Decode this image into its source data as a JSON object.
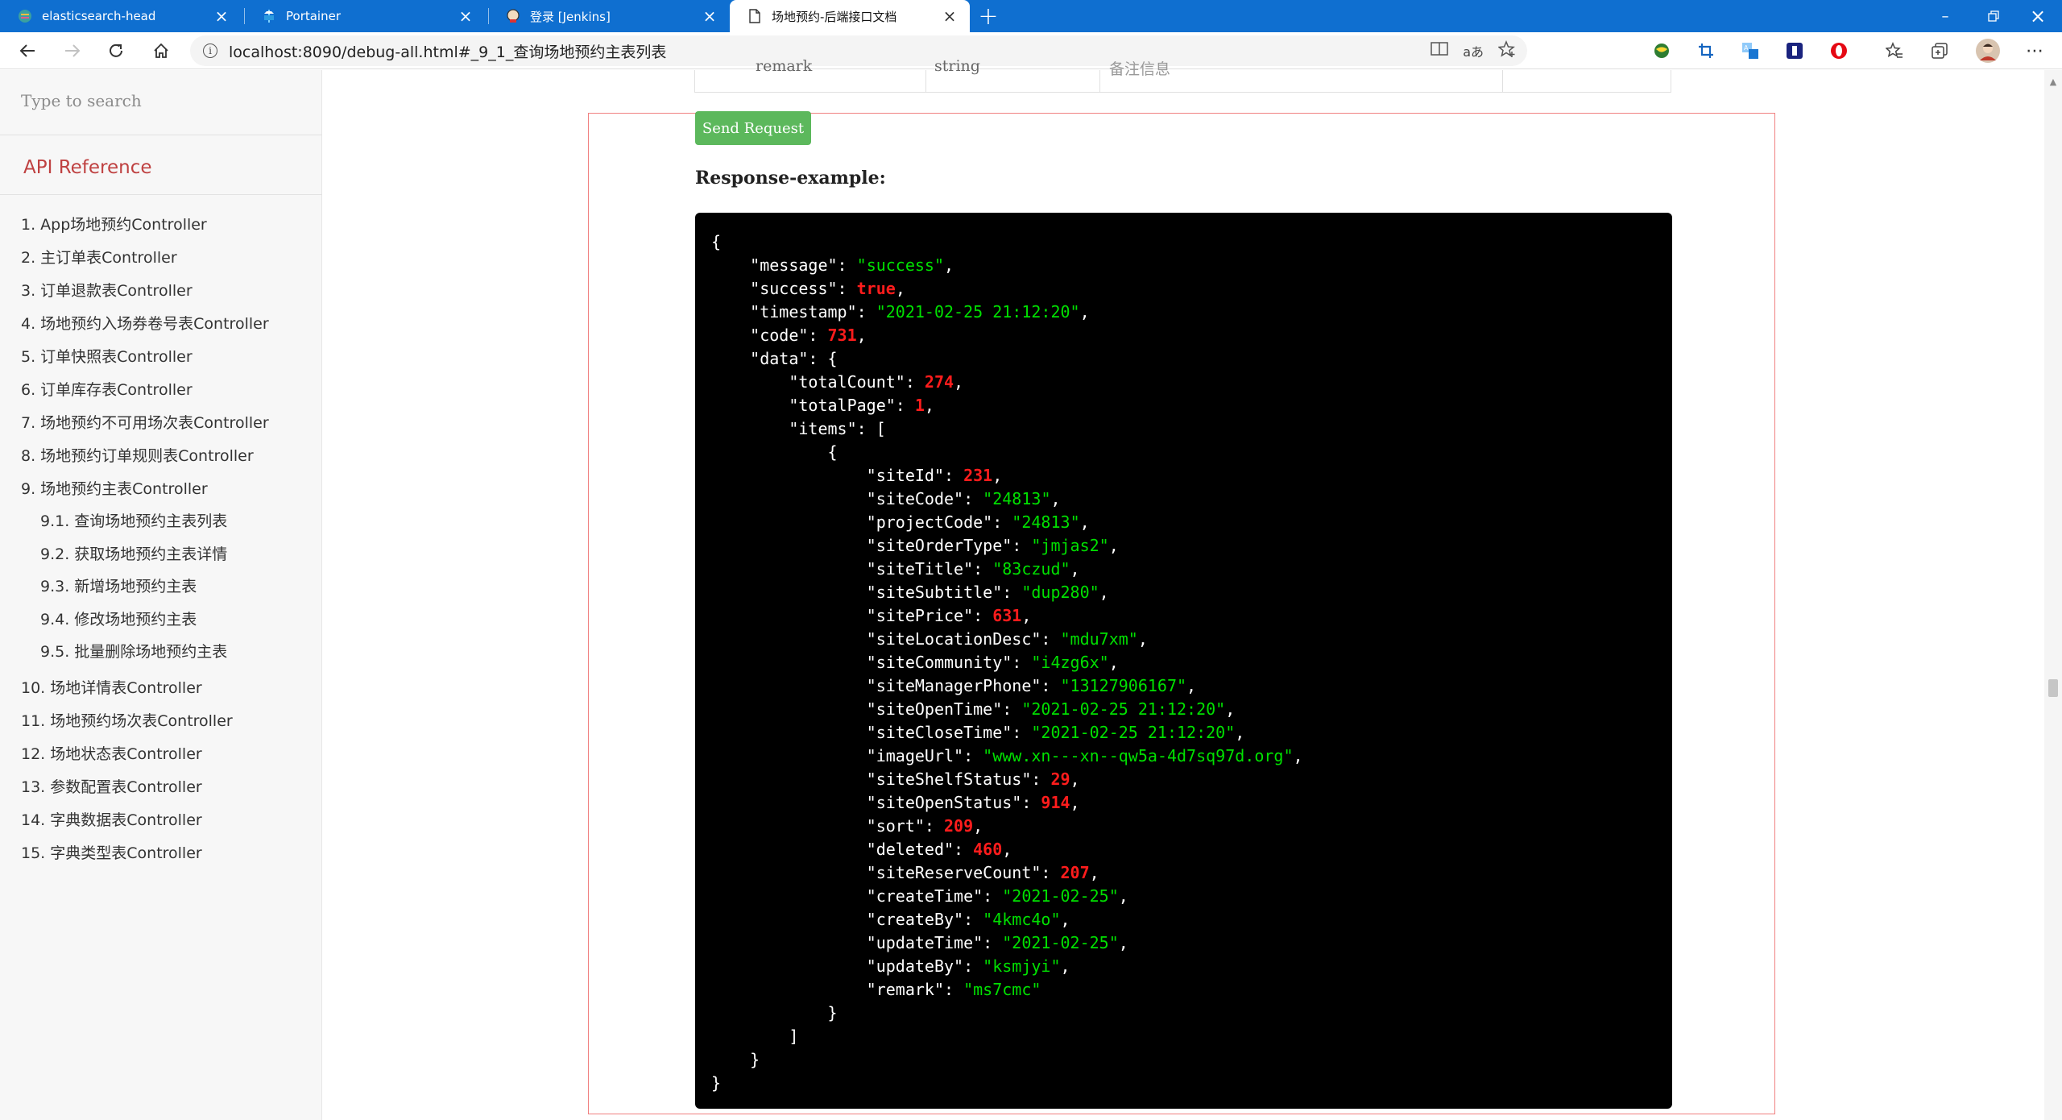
{
  "browser": {
    "tabs": [
      {
        "title": "elasticsearch-head",
        "icon": "elasticsearch-icon",
        "active": false
      },
      {
        "title": "Portainer",
        "icon": "portainer-icon",
        "active": false
      },
      {
        "title": "登录 [Jenkins]",
        "icon": "jenkins-icon",
        "active": false
      },
      {
        "title": "场地预约-后端接口文档",
        "icon": "document-icon",
        "active": true
      }
    ],
    "url": "localhost:8090/debug-all.html#_9_1_查询场地预约主表列表"
  },
  "sidebar": {
    "search_placeholder": "Type to search",
    "section_title": "API Reference",
    "items": [
      {
        "label": "1. App场地预约Controller",
        "level": 1
      },
      {
        "label": "2. 主订单表Controller",
        "level": 1
      },
      {
        "label": "3. 订单退款表Controller",
        "level": 1
      },
      {
        "label": "4. 场地预约入场券卷号表Controller",
        "level": 1
      },
      {
        "label": "5. 订单快照表Controller",
        "level": 1
      },
      {
        "label": "6. 订单库存表Controller",
        "level": 1
      },
      {
        "label": "7. 场地预约不可用场次表Controller",
        "level": 1
      },
      {
        "label": "8. 场地预约订单规则表Controller",
        "level": 1
      },
      {
        "label": "9. 场地预约主表Controller",
        "level": 1
      },
      {
        "label": "9.1. 查询场地预约主表列表",
        "level": 2
      },
      {
        "label": "9.2. 获取场地预约主表详情",
        "level": 2
      },
      {
        "label": "9.3. 新增场地预约主表",
        "level": 2
      },
      {
        "label": "9.4. 修改场地预约主表",
        "level": 2
      },
      {
        "label": "9.5. 批量删除场地预约主表",
        "level": 2
      },
      {
        "label": "10. 场地详情表Controller",
        "level": 1
      },
      {
        "label": "11. 场地预约场次表Controller",
        "level": 1
      },
      {
        "label": "12. 场地状态表Controller",
        "level": 1
      },
      {
        "label": "13. 参数配置表Controller",
        "level": 1
      },
      {
        "label": "14. 字典数据表Controller",
        "level": 1
      },
      {
        "label": "15. 字典类型表Controller",
        "level": 1
      }
    ]
  },
  "main": {
    "table_partial_row": {
      "param": "remark",
      "type": "string",
      "desc": "备注信息"
    },
    "send_button": "Send Request",
    "response_label": "Response-example:",
    "response": {
      "message": "success",
      "success": "true",
      "timestamp": "2021-02-25 21:12:20",
      "code": "731",
      "data": {
        "totalCount": "274",
        "totalPage": "1",
        "item": {
          "siteId": "231",
          "siteCode": "24813",
          "projectCode": "24813",
          "siteOrderType": "jmjas2",
          "siteTitle": "83czud",
          "siteSubtitle": "dup280",
          "sitePrice": "631",
          "siteLocationDesc": "mdu7xm",
          "siteCommunity": "i4zg6x",
          "siteManagerPhone": "13127906167",
          "siteOpenTime": "2021-02-25 21:12:20",
          "siteCloseTime": "2021-02-25 21:12:20",
          "imageUrl": "www.xn---xn--qw5a-4d7sq97d.org",
          "siteShelfStatus": "29",
          "siteOpenStatus": "914",
          "sort": "209",
          "deleted": "460",
          "siteReserveCount": "207",
          "createTime": "2021-02-25",
          "createBy": "4kmc4o",
          "updateTime": "2021-02-25",
          "updateBy": "ksmjyi",
          "remark": "ms7cmc"
        }
      }
    }
  }
}
